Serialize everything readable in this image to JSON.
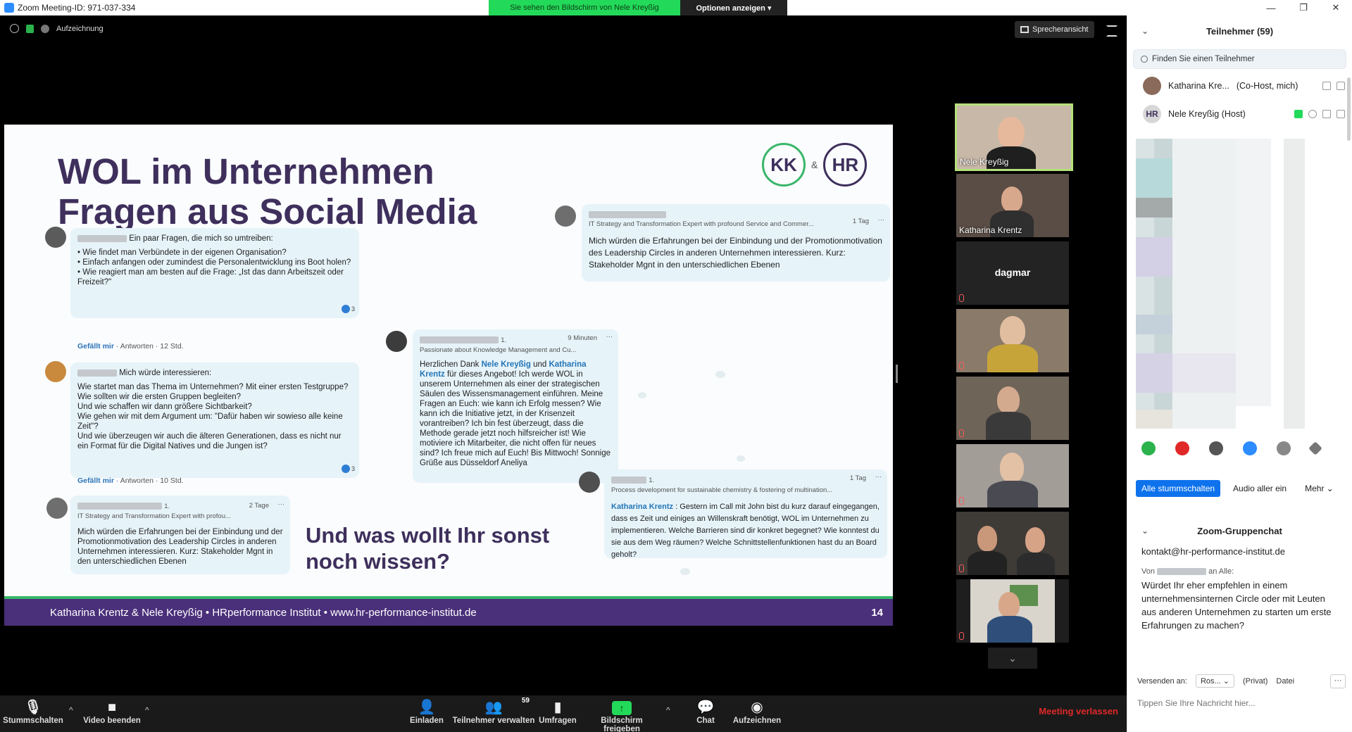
{
  "window": {
    "title": "Zoom Meeting-ID: 971-037-334",
    "share_banner": "Sie sehen den Bildschirm von Nele Kreyßig",
    "options_label": "Optionen anzeigen ▾",
    "controls": [
      "—",
      "❐",
      "✕"
    ]
  },
  "meeting_top": {
    "recording_label": "Aufzeichnung",
    "speaker_view_label": "Sprecheransicht"
  },
  "slide": {
    "title_line1": "WOL im Unternehmen",
    "title_line2": "Fragen aus Social Media",
    "logo_left": "KK",
    "logo_amp": "&",
    "logo_right": "HR",
    "post1": {
      "lead": "Ein paar Fragen, die mich so umtreiben:",
      "lines": [
        "• Wie findet man Verbündete in der eigenen Organisation?",
        "• Einfach anfangen oder zumindest die Personalentwicklung ins Boot holen?",
        "• Wie reagiert man am besten auf die Frage: „Ist das dann Arbeitszeit oder Freizeit?\""
      ],
      "like": "Gefällt mir",
      "reply": "· Antworten · 12 Std.",
      "reactions": "3"
    },
    "post2": {
      "lead": "Mich würde interessieren:",
      "lines": [
        "Wie startet man das Thema im Unternehmen? Mit einer ersten Testgruppe?",
        "Wie sollten wir die ersten Gruppen begleiten?",
        "Und wie schaffen wir dann größere Sichtbarkeit?",
        "Wie gehen wir mit dem Argument um: \"Dafür haben wir sowieso alle keine Zeit\"?",
        "Und wie überzeugen wir auch die älteren Generationen, dass es nicht nur ein Format für die Digital Natives und die Jungen ist?"
      ],
      "like": "Gefällt mir",
      "reply": "· Antworten · 10 Std.",
      "reactions": "3"
    },
    "post3": {
      "degree": "1.",
      "headline": "IT Strategy and Transformation Expert with profou...",
      "time": "2 Tage",
      "text": "Mich würden die Erfahrungen bei der Einbindung und der Promotionmotivation des Leadership Circles in anderen Unternehmen interessieren. Kurz: Stakeholder Mgnt in den unterschiedlichen Ebenen"
    },
    "post4": {
      "degree": "1.",
      "headline": "Passionate about Knowledge Management and Cu...",
      "time": "9 Minuten",
      "text_a": "Herzlichen Dank ",
      "mention_a": "Nele Kreyßig",
      "text_b": " und ",
      "mention_b": "Katharina Krentz",
      "text_c": " für dieses Angebot! Ich werde WOL in unserem Unternehmen als einer der strategischen Säulen des Wissensmanagement einführen. Meine Fragen an Euch: wie kann ich Erfolg messen? Wie kann ich die Initiative jetzt, in der Krisenzeit vorantreiben? Ich bin fest überzeugt, dass die Methode gerade jetzt noch hilfsreicher ist! Wie motiviere ich Mitarbeiter, die nicht offen für neues sind? Ich freue mich auf Euch! Bis Mittwoch! Sonnige Grüße aus Düsseldorf Aneliya"
    },
    "post5": {
      "headline": "IT Strategy and Transformation Expert with profound Service and Commer...",
      "time": "1 Tag",
      "text": "Mich würden die Erfahrungen bei der Einbindung und der Promotionmotivation des Leadership Circles in anderen Unternehmen interessieren. Kurz: Stakeholder Mgnt in den unterschiedlichen Ebenen"
    },
    "post6": {
      "degree": "1.",
      "headline": "Process development for sustainable chemistry & fostering of multination...",
      "time": "1 Tag",
      "mention": "Katharina Krentz",
      "text": " : Gestern im Call mit John bist du kurz darauf eingegangen, dass es Zeit und einiges an Willenskraft benötigt, WOL im Unternehmen zu implementieren. Welche Barrieren sind dir konkret begegnet? Wie konntest du sie aus dem Weg räumen? Welche Schnittstellenfunktionen hast du an Board geholt?"
    },
    "more_dots": "···",
    "question_line1": "Und was wollt Ihr sonst",
    "question_line2": "noch wissen?",
    "footer_text": "Katharina Krentz & Nele Kreyßig  •  HRperformance Institut  •  www.hr-performance-institut.de",
    "page_number": "14"
  },
  "tiles": {
    "names": [
      "Nele Kreyßig",
      "Katharina Krentz",
      "dagmar"
    ],
    "scroll_down": "⌄"
  },
  "toolbar": {
    "mute": "Stummschalten",
    "video": "Video beenden",
    "invite": "Einladen",
    "participants": "Teilnehmer verwalten",
    "participants_count": "59",
    "polls": "Umfragen",
    "share": "Bildschirm freigeben",
    "chat": "Chat",
    "record": "Aufzeichnen",
    "leave": "Meeting verlassen",
    "caret": "^"
  },
  "panel": {
    "title": "Teilnehmer (59)",
    "collapse": "⌄",
    "search_placeholder": "Finden Sie einen Teilnehmer",
    "participants": [
      {
        "name": "Katharina Kre...",
        "role": "(Co-Host, mich)"
      },
      {
        "name": "Nele Kreyßig (Host)",
        "avatar_text": "HR"
      }
    ],
    "mute_all": "Alle stummschalten",
    "unmute_all": "Audio aller ein",
    "more": "Mehr ⌄",
    "chat_title": "Zoom-Gruppenchat",
    "chat_email": "kontakt@hr-performance-institut.de",
    "chat_from": "Von",
    "chat_to": "an Alle:",
    "chat_message": "Würdet Ihr eher empfehlen in einem unternehmensinternen Circle oder mit Leuten aus anderen Unternehmen zu starten um erste Erfahrungen zu machen?",
    "send_to_label": "Versenden an:",
    "send_to_value": "Ros... ⌄",
    "private_label": "(Privat)",
    "file_label": "Datei",
    "more_dots": "···",
    "input_placeholder": "Tippen Sie Ihre Nachricht hier..."
  },
  "colors": {
    "zoom_blue": "#0e72ed",
    "share_green": "#23d959",
    "slide_purple": "#4a2f7a",
    "leave_red": "#e02828"
  }
}
